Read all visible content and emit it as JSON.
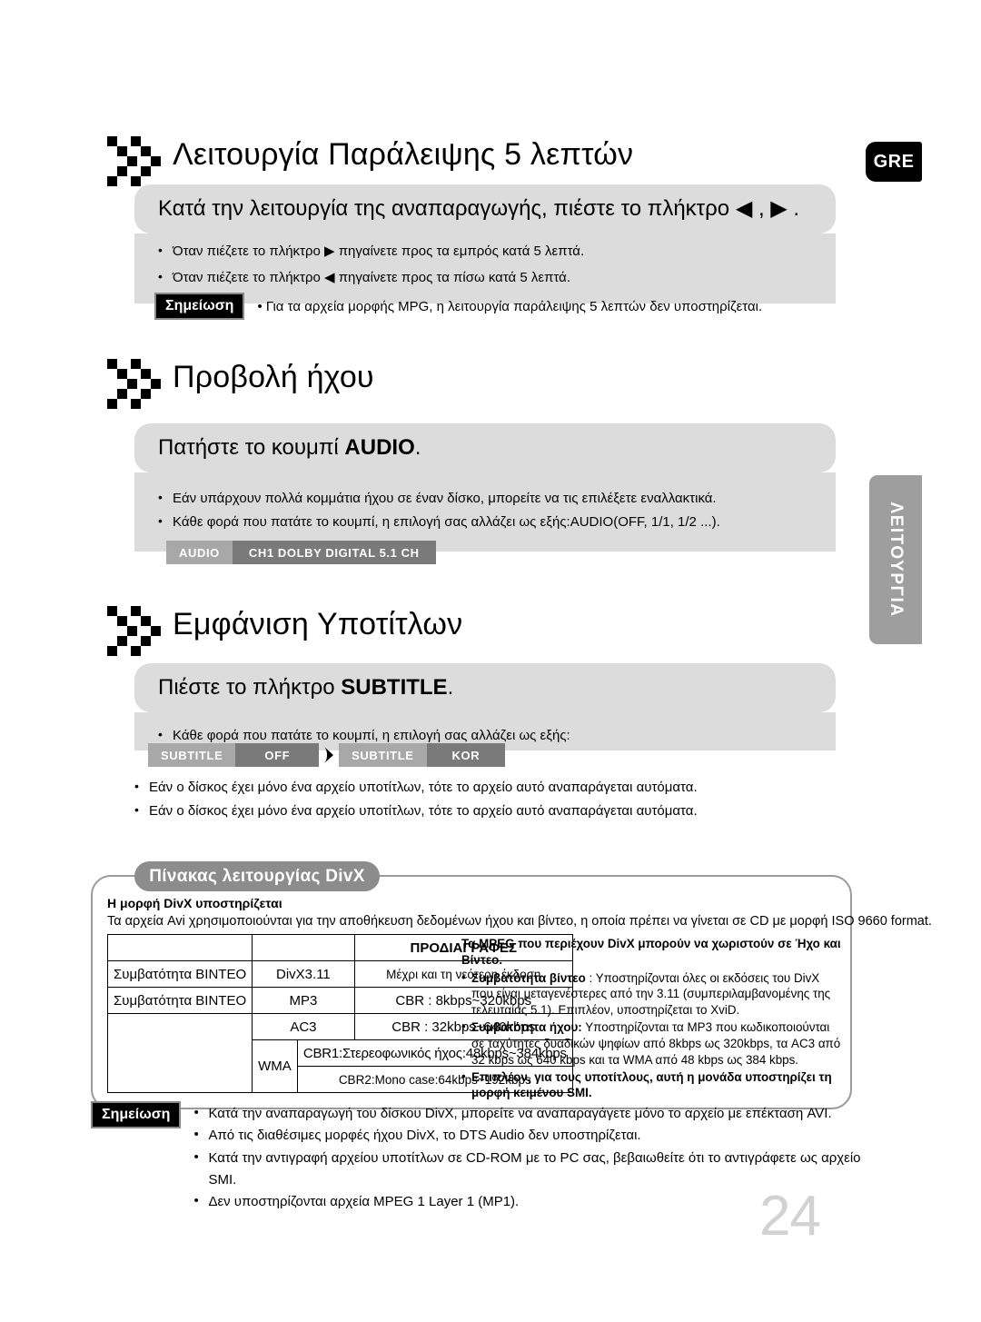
{
  "page": {
    "language_badge": "GRE",
    "side_tab": "ΛΕΙΤΟΥΡΓΙΑ",
    "number": "24"
  },
  "sections": [
    {
      "icon": "double-chevron-icon",
      "title": "Λειτουργία Παράλειψης 5 λεπτών",
      "instruction": "Κατά την λειτουργία της αναπαραγωγής, πιέστε το πλήκτρο ◀ , ▶ .",
      "bullets": [
        "Όταν πιέζετε το πλήκτρο ▶  πηγαίνετε προς τα εμπρός κατά 5 λεπτά.",
        "Όταν πιέζετε το πλήκτρο ◀ πηγαίνετε προς τα πίσω κατά 5 λεπτά."
      ],
      "note_label": "Σημείωση",
      "note_text": "• Για τα αρχεία μορφής MPG, η λειτουργία παράλειψης 5 λεπτών δεν υποστηρίζεται."
    },
    {
      "icon": "double-chevron-icon",
      "title": "Προβολή ήχου",
      "instruction_prefix": "Πατήστε το κουμπί ",
      "instruction_key": "AUDIO",
      "instruction_suffix": ".",
      "bullets": [
        "Εάν υπάρχουν πολλά κομμάτια ήχου σε έναν δίσκο, μπορείτε να τις επιλέξετε εναλλακτικά.",
        "Κάθε φορά που πατάτε το κουμπί, η επιλογή σας αλλάζει ως εξής:AUDIO(OFF, 1/1, 1/2 ...)."
      ],
      "osd": {
        "left": "AUDIO",
        "right": "CH1 DOLBY DIGITAL 5.1 CH"
      }
    },
    {
      "icon": "double-chevron-icon",
      "title": "Εμφάνιση Υποτίτλων",
      "instruction_prefix": "Πιέστε το πλήκτρο ",
      "instruction_key": "SUBTITLE",
      "instruction_suffix": ".",
      "bullets_top": [
        "Κάθε φορά που πατάτε το κουμπί, η επιλογή σας αλλάζει ως εξής:"
      ],
      "osd_a": {
        "left": "SUBTITLE",
        "right": "OFF"
      },
      "osd_b": {
        "left": "SUBTITLE",
        "right": "KOR"
      },
      "bullets_bottom": [
        "Εάν ο δίσκος έχει μόνο ένα αρχείο υποτίτλων, τότε το αρχείο αυτό αναπαράγεται αυτόματα.",
        "Εάν ο δίσκος έχει μόνο ένα αρχείο υποτίτλων, τότε το αρχείο αυτό αναπαράγεται αυτόματα."
      ]
    }
  ],
  "divx": {
    "pill_title": "Πίνακας λειτουργίας DivX",
    "heading": "Η μορφή DivX υποστηρίζεται",
    "subheading": "Τα αρχεία Avi χρησιμοποιούνται για την αποθήκευση δεδομένων ήχου και βίντεο, η οποία πρέπει να γίνεται σε CD με μορφή ISO 9660 format.",
    "table": {
      "spec_header": "ΠΡΟΔΙΑΓΡΑΦΕΣ",
      "rows": [
        {
          "label": "Συμβατότητα ΒΙΝΤΕΟ",
          "codec": "DivX3.11",
          "spec": "Μέχρι και τη νεότερη έκδοση"
        },
        {
          "label": "Συμβατότητα ΒΙΝΤΕΟ",
          "codec": "MP3",
          "spec": "CBR : 8kbps~320kbps"
        },
        {
          "label": "",
          "codec": "AC3",
          "spec": "CBR : 32kbps~640kbps"
        },
        {
          "label": "",
          "codec": "WMA",
          "spec": "CBR1:Στερεοφωνικός ήχος:48kbps~384kbps"
        },
        {
          "label": "",
          "codec": "",
          "spec": "CBR2:Mono case:64kbps~192kbps"
        }
      ]
    },
    "right_title": "Τα MPEG που περιέχουν DivX μπορούν να χωριστούν σε Ήχο και Βίντεο.",
    "right_items": [
      {
        "bold": "Συμβατότητα βίντεο",
        "rest": " : Υποστηρίζονται όλες οι εκδόσεις του DivX που είναι μεταγενέστερες από την 3.11 (συμπεριλαμβανομένης της τελευταίας 5.1). Επιπλέον, υποστηρίζεται το XviD."
      },
      {
        "bold": "Συμβατότητα ήχου:",
        "rest": " Υποστηρίζονται τα MP3 που κωδικοποιούνται σε ταχύτητες δυαδικών ψηφίων από 8kbps ως 320kbps, τα AC3 από 32 kbps ως 640 kbps και τα WMA από 48 kbps ως 384 kbps."
      },
      {
        "bold": "Επιπλέον, για τους υποτίτλους, αυτή η μονάδα υποστηρίζει τη μορφή κειμένου SMI.",
        "rest": ""
      }
    ]
  },
  "bottom_note": {
    "label": "Σημείωση",
    "items": [
      "Κατά την αναπαραγωγή του δίσκου DivX, μπορείτε να αναπαραγάγετε μόνο το αρχείο με επέκταση AVI.",
      "Από τις διαθέσιμες μορφές ήχου DivX, το DTS Audio δεν υποστηρίζεται.",
      "Κατά την αντιγραφή αρχείου υποτίτλων σε CD-ROM με το PC σας, βεβαιωθείτε ότι το αντιγράφετε ως αρχείο SMI.",
      "Δεν υποστηρίζονται αρχεία MPEG 1 Layer 1 (MP1)."
    ]
  },
  "colors": {
    "grey_bar": "#dcdcdc",
    "osd_left": "#a8a8a8",
    "osd_right": "#7a7a7a",
    "side_tab": "#9e9e9e",
    "page_number": "#d2d2d2"
  }
}
